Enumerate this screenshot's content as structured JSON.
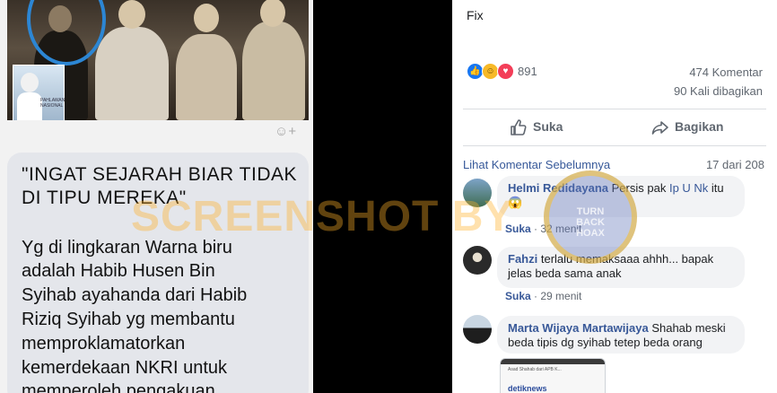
{
  "post_image": {
    "thumb_caption": "PAHLAWAN NASIONAL",
    "add_reaction_icon": "add-emoji-icon",
    "message_lines": [
      "\"INGAT SEJARAH BIAR TIDAK",
      "DI TIPU MEREKA\"",
      "Yg di lingkaran Warna biru",
      "adalah Habib Husen Bin",
      "Syihab ayahanda dari Habib",
      "Riziq Syihab yg membantu",
      "memproklamatorkan",
      "kemerdekaan NKRI untuk",
      "memperoleh pengakuan"
    ]
  },
  "post": {
    "text": "Fix",
    "reaction_icons": [
      "like-icon",
      "haha-icon",
      "love-icon"
    ],
    "reaction_colors": {
      "like": "#1877f2",
      "haha": "#f7b928",
      "love": "#f33e58"
    },
    "reaction_count": "891",
    "comment_count": "474 Komentar",
    "share_count": "90 Kali dibagikan",
    "like_label": "Suka",
    "share_label": "Bagikan"
  },
  "comments_section": {
    "prev_link": "Lihat Komentar Sebelumnya",
    "count": "17 dari 208",
    "comments": [
      {
        "name": "Helmi Redidayana",
        "text": "Persis pak",
        "tag": "Ip U Nk",
        "suffix": "itu",
        "emoji": "😱",
        "like": "Suka",
        "time": "32 menit"
      },
      {
        "name": "Fahzi",
        "text": "terlalu memaksaaa ahhh... bapak",
        "text2": "jelas beda sama anak",
        "like": "Suka",
        "time": "29 menit"
      },
      {
        "name": "Marta Wijaya Martawijaya",
        "text": "Shahab meski",
        "text2": "beda tipis dg syihab tetep beda orang",
        "mini_url": "Asad Shahab dari APB K...",
        "mini_logo": "detiknews"
      }
    ]
  },
  "watermark": {
    "text": "SCREENSHOT BY",
    "logo_text_1": "TURN",
    "logo_text_2": "BACK",
    "logo_text_3": "HOAX",
    "logo_color": "#f5be28"
  }
}
